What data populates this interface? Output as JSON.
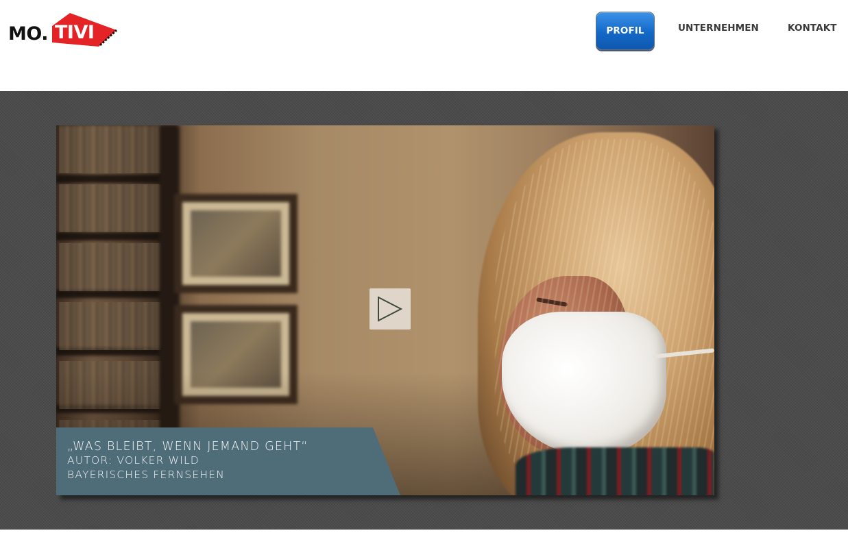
{
  "brand": {
    "logo_text": "MO.TIVI",
    "logo_colors": {
      "red": "#e42326",
      "black": "#111111"
    }
  },
  "nav": {
    "items": [
      {
        "label": "PROFIL",
        "active": true
      },
      {
        "label": "UNTERNEHMEN",
        "active": false
      },
      {
        "label": "KONTAKT",
        "active": false
      }
    ],
    "active_color": "#1b6fd0"
  },
  "hero": {
    "video": {
      "play_icon": "play-icon",
      "caption": {
        "title": "„WAS BLEIBT, WENN JEMAND GEHT“",
        "author": "AUTOR: VOLKER WILD",
        "broadcaster": "BAYERISCHES FERNSEHEN",
        "background_color": "#4f6d78"
      }
    },
    "background_color": "#4b4b4b"
  }
}
